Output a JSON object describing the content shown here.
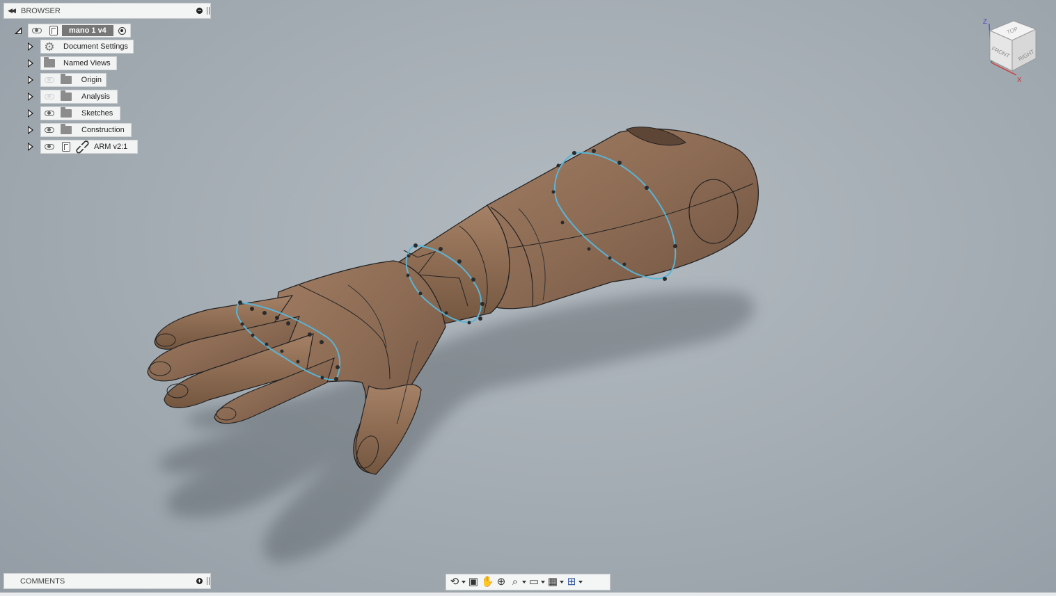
{
  "browser": {
    "title": "BROWSER",
    "root": {
      "label": "mano 1 v4"
    },
    "items": [
      {
        "label": "Document Settings",
        "icon": "gear-icon",
        "visibility": "none"
      },
      {
        "label": "Named Views",
        "icon": "folder-icon",
        "visibility": "none"
      },
      {
        "label": "Origin",
        "icon": "folder-icon",
        "visibility": "hidden"
      },
      {
        "label": "Analysis",
        "icon": "folder-icon",
        "visibility": "hidden"
      },
      {
        "label": "Sketches",
        "icon": "folder-icon",
        "visibility": "visible"
      },
      {
        "label": "Construction",
        "icon": "folder-icon",
        "visibility": "visible"
      },
      {
        "label": "ARM v2:1",
        "icon": "component-link-icon",
        "visibility": "visible"
      }
    ]
  },
  "comments": {
    "title": "COMMENTS"
  },
  "viewcube": {
    "top": "TOP",
    "front": "FRONT",
    "right": "RIGHT",
    "axis_z": "Z",
    "axis_x": "X"
  },
  "navbar": {
    "tools": [
      "orbit-icon",
      "look-at-icon",
      "pan-icon",
      "zoom-icon",
      "fit-icon",
      "display-settings-icon",
      "grid-settings-icon",
      "viewports-icon"
    ]
  },
  "colors": {
    "model": "#8d6c55",
    "sketch_curve": "#5ab4d6",
    "background": "#a6aeb5"
  }
}
